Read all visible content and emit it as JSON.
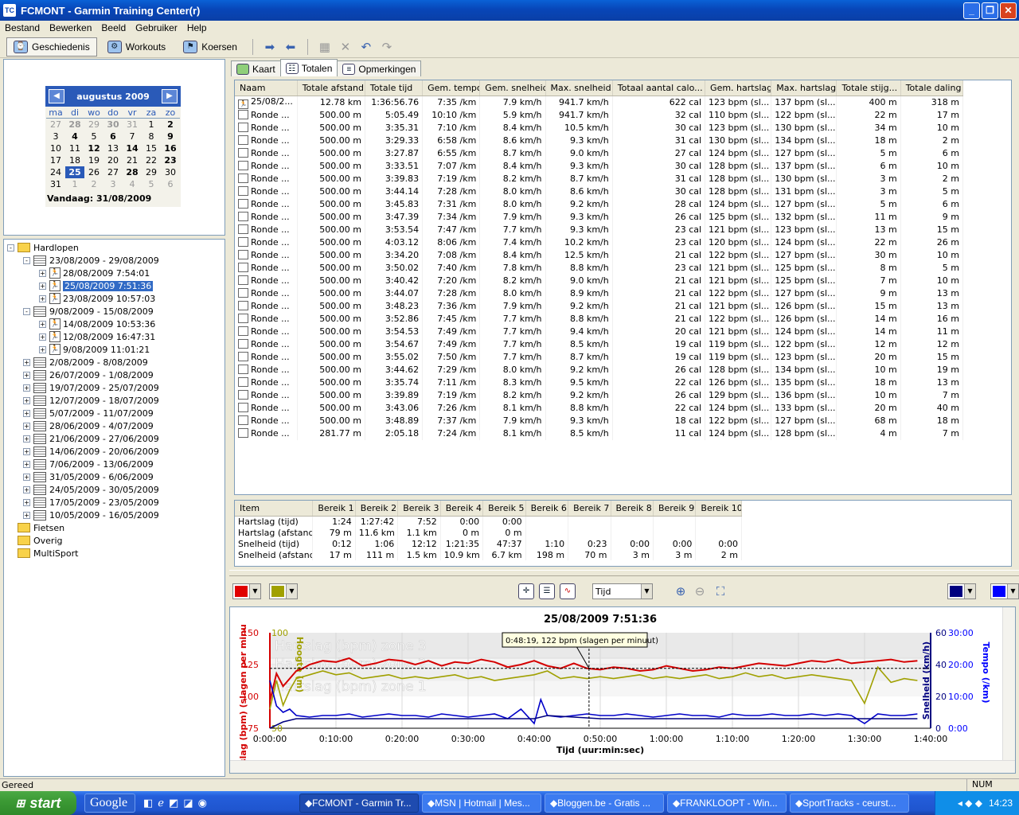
{
  "window": {
    "title": "FCMONT - Garmin Training Center(r)",
    "app_icon": "TC"
  },
  "menu": [
    "Bestand",
    "Bewerken",
    "Beeld",
    "Gebruiker",
    "Help"
  ],
  "toolbar": {
    "history": "Geschiedenis",
    "workouts": "Workouts",
    "courses": "Koersen"
  },
  "calendar": {
    "month": "augustus 2009",
    "dow": [
      "ma",
      "di",
      "wo",
      "do",
      "vr",
      "za",
      "zo"
    ],
    "days": [
      [
        "27",
        "28",
        "29",
        "30",
        "31",
        "1",
        "2"
      ],
      [
        "3",
        "4",
        "5",
        "6",
        "7",
        "8",
        "9"
      ],
      [
        "10",
        "11",
        "12",
        "13",
        "14",
        "15",
        "16"
      ],
      [
        "17",
        "18",
        "19",
        "20",
        "21",
        "22",
        "23"
      ],
      [
        "24",
        "25",
        "26",
        "27",
        "28",
        "29",
        "30"
      ],
      [
        "31",
        "1",
        "2",
        "3",
        "4",
        "5",
        "6"
      ]
    ],
    "today": "Vandaag: 31/08/2009"
  },
  "tree": [
    {
      "label": "Hardlopen",
      "level": 0,
      "type": "folder",
      "exp": "-"
    },
    {
      "label": "23/08/2009 - 29/08/2009",
      "level": 1,
      "type": "week",
      "exp": "-"
    },
    {
      "label": "28/08/2009 7:54:01",
      "level": 2,
      "type": "run",
      "exp": "+"
    },
    {
      "label": "25/08/2009 7:51:36",
      "level": 2,
      "type": "run",
      "exp": "+",
      "selected": true
    },
    {
      "label": "23/08/2009 10:57:03",
      "level": 2,
      "type": "run",
      "exp": "+"
    },
    {
      "label": "9/08/2009 - 15/08/2009",
      "level": 1,
      "type": "week",
      "exp": "-"
    },
    {
      "label": "14/08/2009 10:53:36",
      "level": 2,
      "type": "run",
      "exp": "+"
    },
    {
      "label": "12/08/2009 16:47:31",
      "level": 2,
      "type": "run",
      "exp": "+"
    },
    {
      "label": "9/08/2009 11:01:21",
      "level": 2,
      "type": "run",
      "exp": "+"
    },
    {
      "label": "2/08/2009 - 8/08/2009",
      "level": 1,
      "type": "week",
      "exp": "+"
    },
    {
      "label": "26/07/2009 - 1/08/2009",
      "level": 1,
      "type": "week",
      "exp": "+"
    },
    {
      "label": "19/07/2009 - 25/07/2009",
      "level": 1,
      "type": "week",
      "exp": "+"
    },
    {
      "label": "12/07/2009 - 18/07/2009",
      "level": 1,
      "type": "week",
      "exp": "+"
    },
    {
      "label": "5/07/2009 - 11/07/2009",
      "level": 1,
      "type": "week",
      "exp": "+"
    },
    {
      "label": "28/06/2009 - 4/07/2009",
      "level": 1,
      "type": "week",
      "exp": "+"
    },
    {
      "label": "21/06/2009 - 27/06/2009",
      "level": 1,
      "type": "week",
      "exp": "+"
    },
    {
      "label": "14/06/2009 - 20/06/2009",
      "level": 1,
      "type": "week",
      "exp": "+"
    },
    {
      "label": "7/06/2009 - 13/06/2009",
      "level": 1,
      "type": "week",
      "exp": "+"
    },
    {
      "label": "31/05/2009 - 6/06/2009",
      "level": 1,
      "type": "week",
      "exp": "+"
    },
    {
      "label": "24/05/2009 - 30/05/2009",
      "level": 1,
      "type": "week",
      "exp": "+"
    },
    {
      "label": "17/05/2009 - 23/05/2009",
      "level": 1,
      "type": "week",
      "exp": "+"
    },
    {
      "label": "10/05/2009 - 16/05/2009",
      "level": 1,
      "type": "week",
      "exp": "+"
    },
    {
      "label": "Fietsen",
      "level": 0,
      "type": "folder",
      "exp": ""
    },
    {
      "label": "Overig",
      "level": 0,
      "type": "folder",
      "exp": ""
    },
    {
      "label": "MultiSport",
      "level": 0,
      "type": "folder",
      "exp": ""
    }
  ],
  "tabs": [
    "Kaart",
    "Totalen",
    "Opmerkingen"
  ],
  "laps": {
    "columns": [
      "Naam",
      "Totale afstand",
      "Totale tijd",
      "Gem. tempo",
      "Gem. snelheid",
      "Max. snelheid",
      "Totaal aantal calo...",
      "Gem. hartslag",
      "Max. hartslag",
      "Totale stijg...",
      "Totale daling"
    ],
    "rows": [
      [
        "25/08/2...",
        "12.78 km",
        "1:36:56.76",
        "7:35 /km",
        "7.9 km/h",
        "941.7 km/h",
        "622 cal",
        "123 bpm (sl...",
        "137 bpm (sl...",
        "400 m",
        "318 m"
      ],
      [
        "Ronde ...",
        "500.00 m",
        "5:05.49",
        "10:10 /km",
        "5.9 km/h",
        "941.7 km/h",
        "32 cal",
        "110 bpm (sl...",
        "122 bpm (sl...",
        "22 m",
        "17 m"
      ],
      [
        "Ronde ...",
        "500.00 m",
        "3:35.31",
        "7:10 /km",
        "8.4 km/h",
        "10.5 km/h",
        "30 cal",
        "123 bpm (sl...",
        "130 bpm (sl...",
        "34 m",
        "10 m"
      ],
      [
        "Ronde ...",
        "500.00 m",
        "3:29.33",
        "6:58 /km",
        "8.6 km/h",
        "9.3 km/h",
        "31 cal",
        "130 bpm (sl...",
        "134 bpm (sl...",
        "18 m",
        "2 m"
      ],
      [
        "Ronde ...",
        "500.00 m",
        "3:27.87",
        "6:55 /km",
        "8.7 km/h",
        "9.0 km/h",
        "27 cal",
        "124 bpm (sl...",
        "127 bpm (sl...",
        "5 m",
        "6 m"
      ],
      [
        "Ronde ...",
        "500.00 m",
        "3:33.51",
        "7:07 /km",
        "8.4 km/h",
        "9.3 km/h",
        "30 cal",
        "128 bpm (sl...",
        "137 bpm (sl...",
        "6 m",
        "10 m"
      ],
      [
        "Ronde ...",
        "500.00 m",
        "3:39.83",
        "7:19 /km",
        "8.2 km/h",
        "8.7 km/h",
        "31 cal",
        "128 bpm (sl...",
        "130 bpm (sl...",
        "3 m",
        "2 m"
      ],
      [
        "Ronde ...",
        "500.00 m",
        "3:44.14",
        "7:28 /km",
        "8.0 km/h",
        "8.6 km/h",
        "30 cal",
        "128 bpm (sl...",
        "131 bpm (sl...",
        "3 m",
        "5 m"
      ],
      [
        "Ronde ...",
        "500.00 m",
        "3:45.83",
        "7:31 /km",
        "8.0 km/h",
        "9.2 km/h",
        "28 cal",
        "124 bpm (sl...",
        "127 bpm (sl...",
        "5 m",
        "6 m"
      ],
      [
        "Ronde ...",
        "500.00 m",
        "3:47.39",
        "7:34 /km",
        "7.9 km/h",
        "9.3 km/h",
        "26 cal",
        "125 bpm (sl...",
        "132 bpm (sl...",
        "11 m",
        "9 m"
      ],
      [
        "Ronde ...",
        "500.00 m",
        "3:53.54",
        "7:47 /km",
        "7.7 km/h",
        "9.3 km/h",
        "23 cal",
        "121 bpm (sl...",
        "123 bpm (sl...",
        "13 m",
        "15 m"
      ],
      [
        "Ronde ...",
        "500.00 m",
        "4:03.12",
        "8:06 /km",
        "7.4 km/h",
        "10.2 km/h",
        "23 cal",
        "120 bpm (sl...",
        "124 bpm (sl...",
        "22 m",
        "26 m"
      ],
      [
        "Ronde ...",
        "500.00 m",
        "3:34.20",
        "7:08 /km",
        "8.4 km/h",
        "12.5 km/h",
        "21 cal",
        "122 bpm (sl...",
        "127 bpm (sl...",
        "30 m",
        "10 m"
      ],
      [
        "Ronde ...",
        "500.00 m",
        "3:50.02",
        "7:40 /km",
        "7.8 km/h",
        "8.8 km/h",
        "23 cal",
        "121 bpm (sl...",
        "125 bpm (sl...",
        "8 m",
        "5 m"
      ],
      [
        "Ronde ...",
        "500.00 m",
        "3:40.42",
        "7:20 /km",
        "8.2 km/h",
        "9.0 km/h",
        "21 cal",
        "121 bpm (sl...",
        "125 bpm (sl...",
        "7 m",
        "10 m"
      ],
      [
        "Ronde ...",
        "500.00 m",
        "3:44.07",
        "7:28 /km",
        "8.0 km/h",
        "8.9 km/h",
        "21 cal",
        "122 bpm (sl...",
        "127 bpm (sl...",
        "9 m",
        "13 m"
      ],
      [
        "Ronde ...",
        "500.00 m",
        "3:48.23",
        "7:36 /km",
        "7.9 km/h",
        "9.2 km/h",
        "21 cal",
        "121 bpm (sl...",
        "126 bpm (sl...",
        "15 m",
        "13 m"
      ],
      [
        "Ronde ...",
        "500.00 m",
        "3:52.86",
        "7:45 /km",
        "7.7 km/h",
        "8.8 km/h",
        "21 cal",
        "122 bpm (sl...",
        "126 bpm (sl...",
        "14 m",
        "16 m"
      ],
      [
        "Ronde ...",
        "500.00 m",
        "3:54.53",
        "7:49 /km",
        "7.7 km/h",
        "9.4 km/h",
        "20 cal",
        "121 bpm (sl...",
        "124 bpm (sl...",
        "14 m",
        "11 m"
      ],
      [
        "Ronde ...",
        "500.00 m",
        "3:54.67",
        "7:49 /km",
        "7.7 km/h",
        "8.5 km/h",
        "19 cal",
        "119 bpm (sl...",
        "122 bpm (sl...",
        "12 m",
        "12 m"
      ],
      [
        "Ronde ...",
        "500.00 m",
        "3:55.02",
        "7:50 /km",
        "7.7 km/h",
        "8.7 km/h",
        "19 cal",
        "119 bpm (sl...",
        "123 bpm (sl...",
        "20 m",
        "15 m"
      ],
      [
        "Ronde ...",
        "500.00 m",
        "3:44.62",
        "7:29 /km",
        "8.0 km/h",
        "9.2 km/h",
        "26 cal",
        "128 bpm (sl...",
        "134 bpm (sl...",
        "10 m",
        "19 m"
      ],
      [
        "Ronde ...",
        "500.00 m",
        "3:35.74",
        "7:11 /km",
        "8.3 km/h",
        "9.5 km/h",
        "22 cal",
        "126 bpm (sl...",
        "135 bpm (sl...",
        "18 m",
        "13 m"
      ],
      [
        "Ronde ...",
        "500.00 m",
        "3:39.89",
        "7:19 /km",
        "8.2 km/h",
        "9.2 km/h",
        "26 cal",
        "129 bpm (sl...",
        "136 bpm (sl...",
        "10 m",
        "7 m"
      ],
      [
        "Ronde ...",
        "500.00 m",
        "3:43.06",
        "7:26 /km",
        "8.1 km/h",
        "8.8 km/h",
        "22 cal",
        "124 bpm (sl...",
        "133 bpm (sl...",
        "20 m",
        "40 m"
      ],
      [
        "Ronde ...",
        "500.00 m",
        "3:48.89",
        "7:37 /km",
        "7.9 km/h",
        "9.3 km/h",
        "18 cal",
        "122 bpm (sl...",
        "127 bpm (sl...",
        "68 m",
        "18 m"
      ],
      [
        "Ronde ...",
        "281.77 m",
        "2:05.18",
        "7:24 /km",
        "8.1 km/h",
        "8.5 km/h",
        "11 cal",
        "124 bpm (sl...",
        "128 bpm (sl...",
        "4 m",
        "7 m"
      ]
    ]
  },
  "zones": {
    "columns": [
      "Item",
      "Bereik 1",
      "Bereik 2",
      "Bereik 3",
      "Bereik 4",
      "Bereik 5",
      "Bereik 6",
      "Bereik 7",
      "Bereik 8",
      "Bereik 9",
      "Bereik 10"
    ],
    "rows": [
      [
        "Hartslag (tijd)",
        "1:24",
        "1:27:42",
        "7:52",
        "0:00",
        "0:00",
        "",
        "",
        "",
        "",
        ""
      ],
      [
        "Hartslag (afstand)",
        "79 m",
        "11.6 km",
        "1.1 km",
        "0 m",
        "0 m",
        "",
        "",
        "",
        "",
        ""
      ],
      [
        "Snelheid (tijd)",
        "0:12",
        "1:06",
        "12:12",
        "1:21:35",
        "47:37",
        "1:10",
        "0:23",
        "0:00",
        "0:00",
        "0:00"
      ],
      [
        "Snelheid (afstand)",
        "17 m",
        "111 m",
        "1.5 km",
        "10.9 km",
        "6.7 km",
        "198 m",
        "70 m",
        "3 m",
        "3 m",
        "2 m"
      ]
    ]
  },
  "chart_toolbar": {
    "xaxis_select": "Tijd",
    "color_left1": "#e00000",
    "color_left2": "#a0a000",
    "color_right1": "#000080",
    "color_right2": "#0000ff"
  },
  "chart_data": {
    "type": "line",
    "title": "25/08/2009 7:51:36",
    "xlabel": "Tijd (uur:min:sec)",
    "x_ticks": [
      "0:00:00",
      "0:10:00",
      "0:20:00",
      "0:30:00",
      "0:40:00",
      "0:50:00",
      "1:00:00",
      "1:10:00",
      "1:20:00",
      "1:30:00",
      "1:40:00"
    ],
    "xlim_min": [
      0,
      100
    ],
    "ylabel_left": "hartslag (bpm) (slagen per minu",
    "ylim_left": [
      75,
      150
    ],
    "yticks_left": [
      "75",
      "100",
      "125",
      "150"
    ],
    "ylabel_left2": "Hoogte (m)",
    "ylim_left2": [
      50,
      100
    ],
    "yticks_left2": [
      "50",
      "100"
    ],
    "ylabel_right": "Snelheid (km/h)",
    "yticks_right": [
      "0",
      "20",
      "40",
      "60"
    ],
    "ylabel_right2": "Tempo (/km)",
    "yticks_right2": [
      "0:00",
      "10:00",
      "20:00",
      "30:00"
    ],
    "zones": [
      "Hartslag (bpm) zone 3",
      "Hartslag (bpm) zone 2",
      "Hartslag (bpm) zone 1"
    ],
    "tooltip": "0:48:19, 122 bpm (slagen per minuut)",
    "series": [
      {
        "name": "Hartslag",
        "color": "#d40000",
        "axis": "left",
        "x": [
          0,
          1,
          2,
          3,
          4,
          5,
          6,
          8,
          10,
          12,
          14,
          16,
          18,
          20,
          22,
          24,
          26,
          28,
          30,
          32,
          34,
          36,
          38,
          40,
          42,
          44,
          46,
          48,
          50,
          52,
          54,
          56,
          58,
          60,
          62,
          64,
          66,
          68,
          70,
          72,
          74,
          76,
          78,
          80,
          82,
          84,
          86,
          88,
          90,
          92,
          94,
          96,
          98
        ],
        "y": [
          96,
          118,
          108,
          114,
          120,
          122,
          125,
          128,
          127,
          130,
          124,
          126,
          129,
          128,
          125,
          128,
          124,
          127,
          126,
          129,
          127,
          123,
          125,
          128,
          124,
          122,
          126,
          122,
          121,
          123,
          122,
          120,
          121,
          124,
          122,
          120,
          121,
          123,
          122,
          124,
          126,
          125,
          124,
          126,
          128,
          127,
          129,
          126,
          127,
          128,
          129,
          127,
          128
        ]
      },
      {
        "name": "Hoogte",
        "color": "#a0a000",
        "axis": "left2",
        "x": [
          0,
          1,
          2,
          3,
          4,
          6,
          8,
          10,
          12,
          14,
          16,
          18,
          20,
          22,
          24,
          26,
          28,
          30,
          32,
          34,
          36,
          38,
          40,
          42,
          44,
          46,
          48,
          50,
          52,
          54,
          56,
          58,
          60,
          62,
          64,
          66,
          68,
          70,
          72,
          74,
          76,
          78,
          80,
          82,
          84,
          86,
          88,
          90,
          92,
          94,
          96,
          98
        ],
        "y": [
          60,
          75,
          62,
          70,
          76,
          78,
          80,
          78,
          79,
          76,
          77,
          78,
          76,
          77,
          76,
          77,
          78,
          76,
          77,
          75,
          76,
          77,
          78,
          80,
          76,
          77,
          76,
          77,
          76,
          77,
          78,
          76,
          77,
          76,
          77,
          78,
          76,
          77,
          79,
          77,
          78,
          76,
          77,
          78,
          77,
          76,
          75,
          63,
          82,
          74,
          76,
          75
        ]
      },
      {
        "name": "Snelheid",
        "color": "#0000c8",
        "axis": "right",
        "x": [
          0,
          1,
          2,
          3,
          4,
          6,
          8,
          10,
          12,
          14,
          16,
          18,
          20,
          22,
          24,
          26,
          28,
          30,
          32,
          34,
          36,
          38,
          40,
          41,
          42,
          44,
          46,
          48,
          50,
          52,
          54,
          56,
          58,
          60,
          62,
          64,
          66,
          68,
          70,
          72,
          74,
          76,
          78,
          80,
          82,
          84,
          86,
          88,
          90,
          92,
          94,
          96,
          98
        ],
        "y": [
          30,
          14,
          10,
          12,
          8,
          7,
          8,
          8,
          9,
          7,
          8,
          9,
          8,
          8,
          7,
          9,
          8,
          7,
          8,
          9,
          6,
          12,
          3,
          18,
          8,
          7,
          8,
          9,
          8,
          8,
          9,
          8,
          7,
          8,
          9,
          8,
          8,
          7,
          9,
          8,
          8,
          9,
          8,
          8,
          9,
          8,
          9,
          8,
          3,
          9,
          8,
          8,
          9
        ]
      },
      {
        "name": "Tempo",
        "color": "#000080",
        "axis": "right2",
        "x": [
          0,
          2,
          4,
          6,
          8,
          10,
          20,
          30,
          40,
          42,
          50,
          60,
          70,
          80,
          90,
          98
        ],
        "y": [
          0,
          2,
          3,
          3,
          3,
          3,
          3,
          3,
          3,
          4,
          3,
          3,
          3,
          3,
          3,
          3
        ]
      }
    ]
  },
  "statusbar": {
    "left": "Gereed",
    "num": "NUM"
  },
  "taskbar": {
    "start": "start",
    "google": "Google",
    "items": [
      "FCMONT - Garmin Tr...",
      "MSN | Hotmail | Mes...",
      "Bloggen.be - Gratis ...",
      "FRANKLOOPT - Win...",
      "SportTracks - ceurst..."
    ],
    "clock": "14:23"
  }
}
